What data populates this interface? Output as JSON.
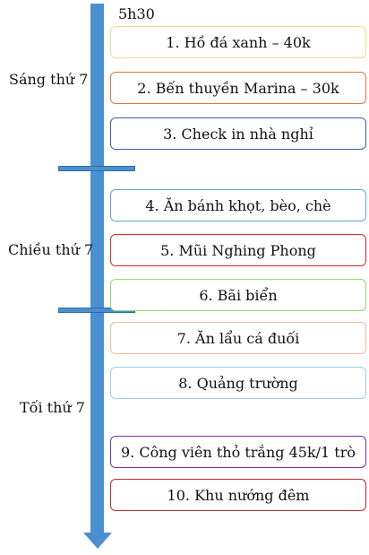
{
  "start_time": "5h30",
  "colors": {
    "timeline": "#4a90d0"
  },
  "periods": [
    {
      "label": "Sáng thứ 7",
      "activities": [
        {
          "label": "1. Hồ đá xanh – 40k",
          "border_color": "#f5d98a"
        },
        {
          "label": "2. Bến thuyền Marina – 30k",
          "border_color": "#e0763a"
        },
        {
          "label": "3. Check in nhà nghỉ",
          "border_color": "#3f5f9c"
        }
      ]
    },
    {
      "label": "Chiều thứ 7",
      "activities": [
        {
          "label": "4. Ăn bánh khọt, bèo, chè",
          "border_color": "#5aa5d8"
        },
        {
          "label": "5. Mũi Nghing Phong",
          "border_color": "#d9272e"
        },
        {
          "label": "6. Bãi biển",
          "border_color": "#8fdc6a"
        }
      ]
    },
    {
      "label": "Tối thứ 7",
      "activities": [
        {
          "label": "7. Ăn lẩu cá đuối",
          "border_color": "#f7b89a"
        },
        {
          "label": "8. Quảng trường",
          "border_color": "#9ccbe6"
        },
        {
          "label": "9. Công viên thỏ trắng 45k/1 trò",
          "border_color": "#7b2fa1"
        },
        {
          "label": "10. Khu nướng đêm",
          "border_color": "#c0272d"
        }
      ]
    }
  ]
}
